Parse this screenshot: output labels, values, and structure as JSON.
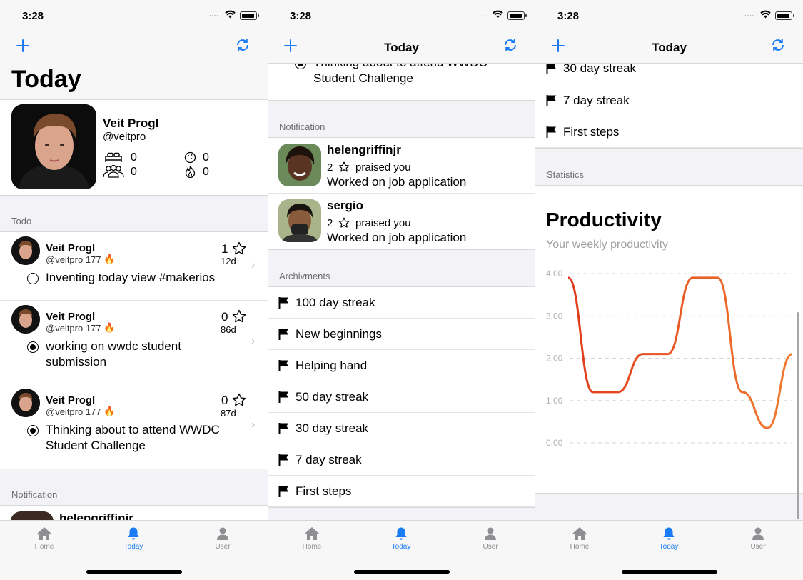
{
  "status": {
    "time": "3:28",
    "signal": "....",
    "icons": [
      "wifi-icon",
      "battery-icon"
    ]
  },
  "nav": {
    "title": "Today",
    "add_icon": "plus-icon",
    "refresh_icon": "refresh-icon"
  },
  "profile": {
    "name": "Veit Progl",
    "handle": "@veitpro",
    "stats": {
      "beds": "0",
      "group": "0",
      "cookie": "0",
      "flame": "0"
    }
  },
  "sections": {
    "todo": "Todo",
    "notification": "Notification",
    "achievements": "Archivments",
    "statistics": "Statistics"
  },
  "todos": [
    {
      "name": "Veit Progl",
      "handle": "@veitpro 177",
      "emoji": "🔥",
      "count": "1",
      "days": "12d",
      "done": false,
      "text": "Inventing today view #makerios"
    },
    {
      "name": "Veit Progl",
      "handle": "@veitpro 177",
      "emoji": "🔥",
      "count": "0",
      "days": "86d",
      "done": true,
      "text": "working on wwdc student submission"
    },
    {
      "name": "Veit Progl",
      "handle": "@veitpro 177",
      "emoji": "🔥",
      "count": "0",
      "days": "87d",
      "done": true,
      "text": "Thinking about to attend WWDC Student Challenge"
    }
  ],
  "notifications": [
    {
      "user": "helengriffinjr",
      "count": "2",
      "action": "praised you",
      "text": "Worked on job application"
    },
    {
      "user": "sergio",
      "count": "2",
      "action": "praised you",
      "text": "Worked on job application"
    }
  ],
  "achievements": [
    "100 day streak",
    "New beginnings",
    "Helping hand",
    "50 day streak",
    "30 day streak",
    "7 day streak",
    "First steps"
  ],
  "statistics": {
    "title": "Productivity",
    "subtitle": "Your weekly productivity"
  },
  "chart_data": {
    "type": "line",
    "title": "Productivity",
    "subtitle": "Your weekly productivity",
    "yticks": [
      "4.00",
      "3.00",
      "2.00",
      "1.00",
      "0.00"
    ],
    "ylim": [
      0,
      4
    ],
    "grid": true,
    "color": "#e8511f",
    "series": [
      {
        "values": [
          3.9,
          1.2,
          1.2,
          2.1,
          2.1,
          3.9,
          3.9,
          1.2,
          0.35,
          2.1
        ]
      }
    ]
  },
  "tabs": [
    {
      "label": "Home",
      "icon": "house-icon"
    },
    {
      "label": "Today",
      "icon": "bell-icon"
    },
    {
      "label": "User",
      "icon": "user-icon"
    }
  ]
}
